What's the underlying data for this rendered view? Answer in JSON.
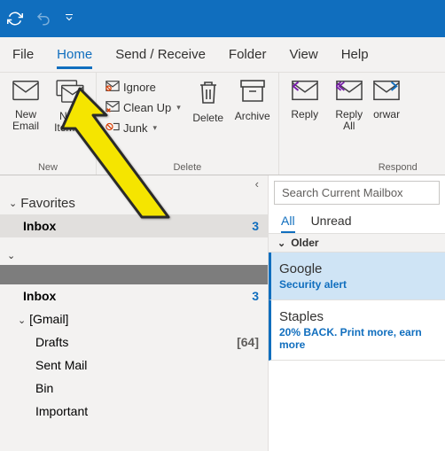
{
  "tabs": {
    "file": "File",
    "home": "Home",
    "sendreceive": "Send / Receive",
    "folder": "Folder",
    "view": "View",
    "help": "Help"
  },
  "ribbon": {
    "new": {
      "label": "New",
      "newEmail": "New\nEmail",
      "newItems": "New\nItems"
    },
    "delete": {
      "label": "Delete",
      "ignore": "Ignore",
      "cleanup": "Clean Up",
      "junk": "Junk",
      "delete": "Delete",
      "archive": "Archive"
    },
    "respond": {
      "label": "Respond",
      "reply": "Reply",
      "replyAll": "Reply\nAll",
      "forward": "Forward"
    }
  },
  "nav": {
    "favorites": "Favorites",
    "inbox": "Inbox",
    "inboxCount": "3",
    "account": "",
    "inbox2": "Inbox",
    "inbox2Count": "3",
    "gmail": "[Gmail]",
    "drafts": "Drafts",
    "draftsCount": "[64]",
    "sentMail": "Sent Mail",
    "bin": "Bin",
    "important": "Important"
  },
  "list": {
    "searchPlaceholder": "Search Current Mailbox",
    "all": "All",
    "unread": "Unread",
    "older": "Older",
    "msg1": {
      "from": "Google",
      "subject": "Security alert"
    },
    "msg2": {
      "from": "Staples",
      "subject": "20% BACK. Print more, earn more"
    }
  }
}
